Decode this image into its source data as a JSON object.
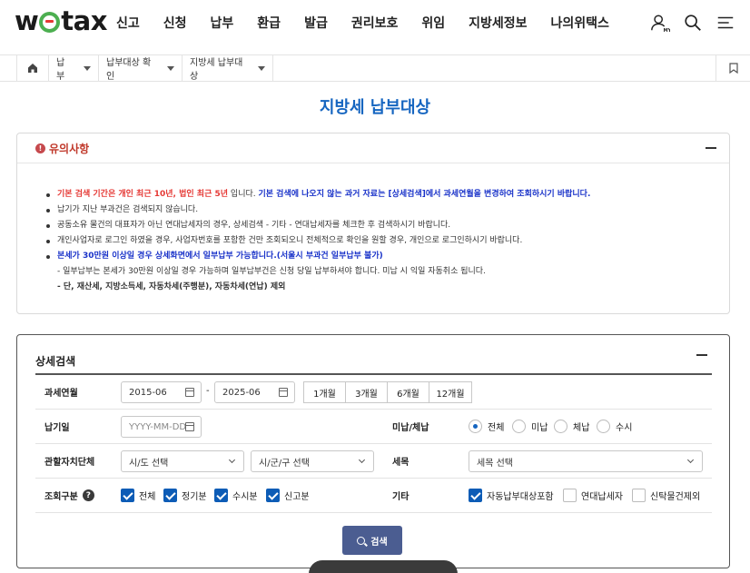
{
  "header": {
    "logo": {
      "pre": "w",
      "post": "tax"
    },
    "nav": [
      "신고",
      "신청",
      "납부",
      "환급",
      "발급",
      "권리보호",
      "위임",
      "지방세정보",
      "나의위택스"
    ],
    "icons": [
      "my-user-icon",
      "search-icon",
      "menu-icon"
    ]
  },
  "breadcrumb": {
    "items": [
      "납부",
      "납부대상 확인",
      "지방세 납부대상"
    ]
  },
  "page_title": "지방세 납부대상",
  "notice": {
    "title": "유의사항",
    "lines": [
      {
        "parts": [
          {
            "t": "기본 검색 기간은 개인 최근 10년, 법인 최근 5년",
            "s": "red"
          },
          {
            "t": " 입니다. ",
            "s": ""
          },
          {
            "t": "기본 검색에 나오지 않는 과거 자료는 [상세검색]에서 과세연월을 변경하여 조회하시기 바랍니다.",
            "s": "blue"
          }
        ],
        "bullet": true
      },
      {
        "parts": [
          {
            "t": "납기가 지난 부과건은 검색되지 않습니다.",
            "s": ""
          }
        ],
        "bullet": true
      },
      {
        "parts": [
          {
            "t": "공동소유 물건의 대표자가 아닌 연대납세자의 경우, 상세검색 - 기타 - 연대납세자를 체크한 후 검색하시기 바랍니다.",
            "s": ""
          }
        ],
        "bullet": true
      },
      {
        "parts": [
          {
            "t": "개인사업자로 로그인 하였을 경우, 사업자번호를 포함한 건만 조회되오니 전체적으로 확인을 원할 경우, 개인으로 로그인하시기 바랍니다.",
            "s": ""
          }
        ],
        "bullet": true
      },
      {
        "parts": [
          {
            "t": "본세가 30만원 이상일 경우 상세화면에서 일부납부 가능합니다.(서울시 부과건 일부납부 불가)",
            "s": "blue"
          }
        ],
        "bullet": true
      },
      {
        "parts": [
          {
            "t": "- 일부납부는 본세가 30만원 이상일 경우 가능하며 일부납부건은 신청 당일 납부하셔야 합니다. 미납 시 익일 자동취소 됩니다.",
            "s": ""
          }
        ],
        "bullet": false
      },
      {
        "parts": [
          {
            "t": "- 단, 재산세, 지방소득세, 자동차세(주행분), 자동차세(연납) 제외",
            "s": "bold"
          }
        ],
        "bullet": false
      }
    ]
  },
  "search": {
    "title": "상세검색",
    "labels": {
      "tax_period": "과세연월",
      "due_date": "납기일",
      "unpaid": "미납/체납",
      "jurisdiction": "관할자치단체",
      "tax_item": "세목",
      "inquiry_type": "조회구분",
      "etc": "기타"
    },
    "tax_period": {
      "from": "2015-06",
      "sep": "-",
      "to": "2025-06"
    },
    "period_buttons": [
      "1개월",
      "3개월",
      "6개월",
      "12개월"
    ],
    "due_date_placeholder": "YYYY-MM-DD",
    "unpaid_options": [
      {
        "label": "전체",
        "checked": true
      },
      {
        "label": "미납",
        "checked": false
      },
      {
        "label": "체납",
        "checked": false
      },
      {
        "label": "수시",
        "checked": false
      }
    ],
    "sido_select": "시/도 선택",
    "sigungu_select": "시/군/구 선택",
    "tax_item_select": "세목 선택",
    "inquiry_options": [
      {
        "label": "전체",
        "checked": true
      },
      {
        "label": "정기분",
        "checked": true
      },
      {
        "label": "수시분",
        "checked": true
      },
      {
        "label": "신고분",
        "checked": true
      }
    ],
    "help_mark": "?",
    "etc_options": [
      {
        "label": "자동납부대상포함",
        "checked": true
      },
      {
        "label": "연대납세자",
        "checked": false
      },
      {
        "label": "신탁물건제외",
        "checked": false
      }
    ],
    "search_button": "검색"
  }
}
